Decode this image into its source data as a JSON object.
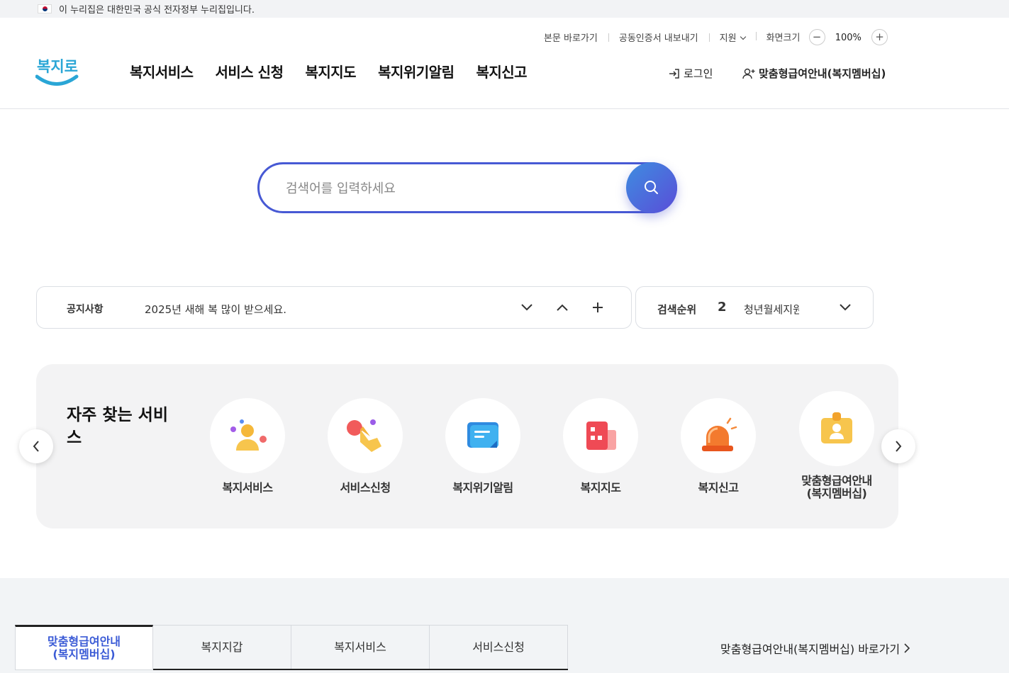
{
  "gov_banner": {
    "text": "이 누리집은 대한민국 공식 전자정부 누리집입니다."
  },
  "utility": {
    "skip_link": "본문 바로가기",
    "cert_export": "공동인증서 내보내기",
    "support": "지원",
    "screen_size": "화면크기",
    "zoom_level": "100%"
  },
  "logo": {
    "text": "복지로"
  },
  "gnb": [
    "복지서비스",
    "서비스 신청",
    "복지지도",
    "복지위기알림",
    "복지신고"
  ],
  "account": {
    "login": "로그인",
    "membership": "맞춤형급여안내(복지멤버십)"
  },
  "search": {
    "placeholder": "검색어를 입력하세요"
  },
  "notice": {
    "label": "공지사항",
    "text": "2025년 새해 복 많이 받으세요."
  },
  "rank": {
    "label": "검색순위",
    "number": "2",
    "keyword": "청년월세지원"
  },
  "quick": {
    "title": "자주 찾는 서비스",
    "services": [
      {
        "name": "복지서비스",
        "icon": "person-icon"
      },
      {
        "name": "서비스신청",
        "icon": "hand-tap-icon"
      },
      {
        "name": "복지위기알림",
        "icon": "message-icon"
      },
      {
        "name": "복지지도",
        "icon": "building-icon"
      },
      {
        "name": "복지신고",
        "icon": "siren-icon"
      },
      {
        "name": "맞춤형급여안내\n(복지멤버십)",
        "icon": "id-badge-icon"
      }
    ]
  },
  "tabs": [
    "맞춤형급여안내\n(복지멤버십)",
    "복지지갑",
    "복지서비스",
    "서비스신청"
  ],
  "shortcut": {
    "text": "맞춤형급여안내(복지멤버십) 바로가기"
  },
  "colors": {
    "accent": "#4759d4",
    "active_tab": "#3b5bd6"
  }
}
